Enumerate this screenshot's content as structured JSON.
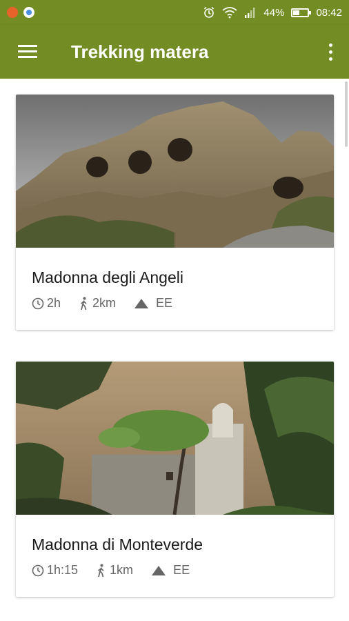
{
  "status_bar": {
    "battery_percent": "44%",
    "battery_level": 0.44,
    "time": "08:42"
  },
  "app_bar": {
    "title": "Trekking matera"
  },
  "trails": [
    {
      "title": "Madonna degli Angeli",
      "duration": "2h",
      "distance": "2km",
      "difficulty": "EE"
    },
    {
      "title": "Madonna di Monteverde",
      "duration": "1h:15",
      "distance": "1km",
      "difficulty": "EE"
    }
  ],
  "colors": {
    "primary": "#748c24",
    "meta_text": "#666666"
  }
}
